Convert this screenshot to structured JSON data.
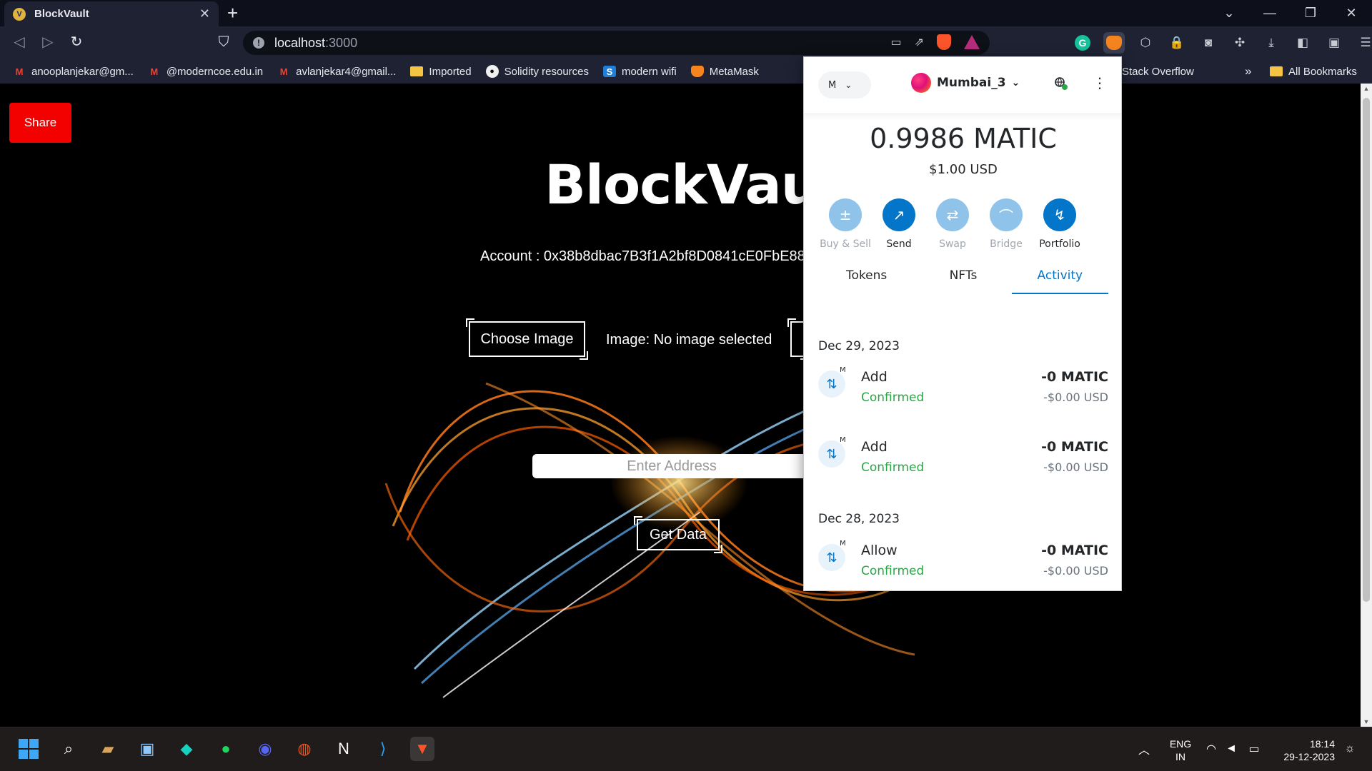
{
  "browser": {
    "tab_title": "BlockVault",
    "url_host": "localhost",
    "url_port": ":3000",
    "bookmarks": [
      {
        "label": "anooplanjekar@gm...",
        "icon": "gmail-icon"
      },
      {
        "label": "@moderncoe.edu.in",
        "icon": "gmail-icon"
      },
      {
        "label": "avlanjekar4@gmail...",
        "icon": "gmail-icon"
      },
      {
        "label": "Imported",
        "icon": "folder-icon"
      },
      {
        "label": "Solidity resources",
        "icon": "github-icon"
      },
      {
        "label": "modern wifi",
        "icon": "s-icon"
      },
      {
        "label": "MetaMask",
        "icon": "metamask-icon"
      }
    ],
    "bookmark_stack_overflow": "Stack Overflow",
    "bookmark_overflow": "»",
    "bookmark_all": "All Bookmarks"
  },
  "page": {
    "share_label": "Share",
    "title": "BlockVault",
    "account": "Account : 0x38b8dbac7B3f1A2bf8D0841cE0FbE88",
    "choose_image_label": "Choose Image",
    "image_status": "Image: No image selected",
    "address_placeholder": "Enter Address",
    "get_data_label": "Get Data"
  },
  "metamask": {
    "network_label": "M",
    "account_name": "Mumbai_3",
    "balance": "0.9986 MATIC",
    "balance_usd": "$1.00 USD",
    "actions": [
      {
        "label": "Buy & Sell",
        "icon": "plus-minus-icon",
        "enabled": false
      },
      {
        "label": "Send",
        "icon": "arrow-up-right-icon",
        "enabled": true
      },
      {
        "label": "Swap",
        "icon": "swap-icon",
        "enabled": false
      },
      {
        "label": "Bridge",
        "icon": "bridge-icon",
        "enabled": false
      },
      {
        "label": "Portfolio",
        "icon": "chart-icon",
        "enabled": true
      }
    ],
    "tabs": [
      "Tokens",
      "NFTs",
      "Activity"
    ],
    "active_tab": "Activity",
    "groups": [
      {
        "date": "Dec 29, 2023",
        "items": [
          {
            "name": "Add",
            "status": "Confirmed",
            "amount": "-0 MATIC",
            "usd": "-$0.00 USD",
            "badge": "M"
          },
          {
            "name": "Add",
            "status": "Confirmed",
            "amount": "-0 MATIC",
            "usd": "-$0.00 USD",
            "badge": "M"
          }
        ]
      },
      {
        "date": "Dec 28, 2023",
        "items": [
          {
            "name": "Allow",
            "status": "Confirmed",
            "amount": "-0 MATIC",
            "usd": "-$0.00 USD",
            "badge": "M"
          }
        ]
      }
    ],
    "accent_color": "#0376c9",
    "confirmed_color": "#28a745"
  },
  "taskbar": {
    "lang_line1": "ENG",
    "lang_line2": "IN",
    "time": "18:14",
    "date": "29-12-2023"
  }
}
